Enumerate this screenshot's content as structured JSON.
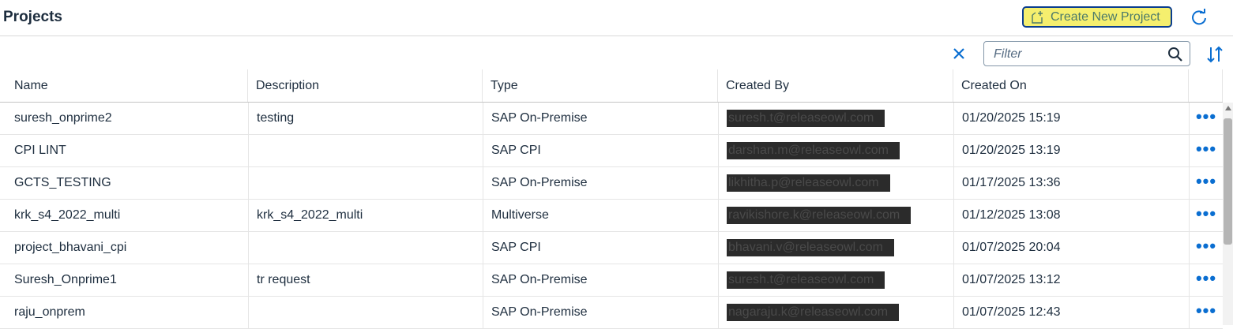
{
  "header": {
    "title": "Projects",
    "create_button_label": "Create New Project"
  },
  "toolbar": {
    "filter_placeholder": "Filter"
  },
  "table": {
    "columns": [
      "Name",
      "Description",
      "Type",
      "Created By",
      "Created On"
    ],
    "rows": [
      {
        "name": "suresh_onprime2",
        "description": "testing",
        "type": "SAP On-Premise",
        "created_by": "suresh.t@releaseowl.com",
        "created_on": "01/20/2025 15:19",
        "more": "•••"
      },
      {
        "name": "CPI LINT",
        "description": "",
        "type": "SAP CPI",
        "created_by": "darshan.m@releaseowl.com",
        "created_on": "01/20/2025 13:19",
        "more": "•••"
      },
      {
        "name": "GCTS_TESTING",
        "description": "",
        "type": "SAP On-Premise",
        "created_by": "likhitha.p@releaseowl.com",
        "created_on": "01/17/2025 13:36",
        "more": "•••"
      },
      {
        "name": "krk_s4_2022_multi",
        "description": "krk_s4_2022_multi",
        "type": "Multiverse",
        "created_by": "ravikishore.k@releaseowl.com",
        "created_on": "01/12/2025 13:08",
        "more": "•••"
      },
      {
        "name": "project_bhavani_cpi",
        "description": "",
        "type": "SAP CPI",
        "created_by": "bhavani.v@releaseowl.com",
        "created_on": "01/07/2025 20:04",
        "more": "•••"
      },
      {
        "name": "Suresh_Onprime1",
        "description": "tr request",
        "type": "SAP On-Premise",
        "created_by": "suresh.t@releaseowl.com",
        "created_on": "01/07/2025 13:12",
        "more": "•••"
      },
      {
        "name": "raju_onprem",
        "description": "",
        "type": "SAP On-Premise",
        "created_by": "nagaraju.k@releaseowl.com",
        "created_on": "01/07/2025 12:43",
        "more": "•••"
      }
    ]
  },
  "icons": {
    "create": "add-project-icon",
    "refresh": "refresh-icon",
    "clear": "close-icon",
    "search": "search-icon",
    "sort": "sort-icon"
  },
  "colors": {
    "accent": "#0a6ed1",
    "create_button_bg": "#f5ef6e",
    "create_button_border": "#0a3d8f",
    "redaction": "#2b2b2b"
  }
}
